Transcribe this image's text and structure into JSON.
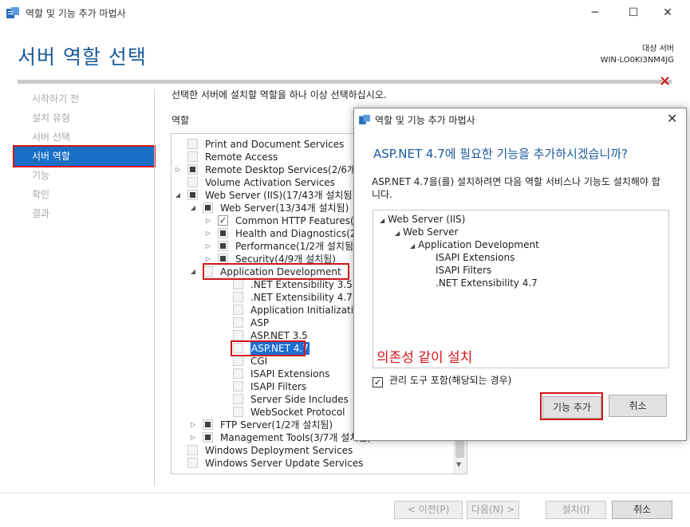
{
  "window": {
    "title": "역할 및 기능 추가 마법사",
    "minimize": "─",
    "maximize": "☐",
    "close": "✕"
  },
  "page": {
    "title": "서버 역할 선택",
    "target_label": "대상 서버",
    "target_server": "WIN-LO0KI3NM4JG",
    "close_mark": "✕"
  },
  "sidebar": {
    "items": [
      {
        "label": "시작하기 전",
        "active": false
      },
      {
        "label": "설치 유형",
        "active": false
      },
      {
        "label": "서버 선택",
        "active": false
      },
      {
        "label": "서버 역할",
        "active": true
      },
      {
        "label": "기능",
        "active": false
      },
      {
        "label": "확인",
        "active": false
      },
      {
        "label": "결과",
        "active": false
      }
    ]
  },
  "main": {
    "instruction": "선택한 서버에 설치할 역할을 하나 이상 선택하십시오.",
    "roles_heading": "역할",
    "tree": [
      {
        "label": "Print and Document Services",
        "state": "empty",
        "arrow": ""
      },
      {
        "label": "Remote Access",
        "state": "empty",
        "arrow": ""
      },
      {
        "label": "Remote Desktop Services(2/6개 설치됨)",
        "state": "partial",
        "arrow": "▷"
      },
      {
        "label": "Volume Activation Services",
        "state": "empty",
        "arrow": ""
      },
      {
        "label": "Web Server (IIS)(17/43개 설치됨)",
        "state": "partial",
        "arrow": "◢"
      },
      {
        "label": "Web Server(13/34개 설치됨)",
        "state": "partial",
        "arrow": "◢"
      },
      {
        "label": "Common HTTP Features(설치됨)",
        "state": "checked",
        "arrow": "▷"
      },
      {
        "label": "Health and Diagnostics(2/6개 설치됨)",
        "state": "partial",
        "arrow": "▷"
      },
      {
        "label": "Performance(1/2개 설치됨)",
        "state": "partial",
        "arrow": "▷"
      },
      {
        "label": "Security(4/9개 설치됨)",
        "state": "partial",
        "arrow": "▷"
      },
      {
        "label": "Application Development",
        "state": "empty",
        "arrow": "◢"
      },
      {
        "label": ".NET Extensibility 3.5",
        "state": "empty",
        "arrow": ""
      },
      {
        "label": ".NET Extensibility 4.7",
        "state": "empty",
        "arrow": ""
      },
      {
        "label": "Application Initialization",
        "state": "empty",
        "arrow": ""
      },
      {
        "label": "ASP",
        "state": "empty",
        "arrow": ""
      },
      {
        "label": "ASP.NET 3.5",
        "state": "empty",
        "arrow": ""
      },
      {
        "label": "ASP.NET 4.7",
        "state": "empty",
        "arrow": ""
      },
      {
        "label": "CGI",
        "state": "empty",
        "arrow": ""
      },
      {
        "label": "ISAPI Extensions",
        "state": "empty",
        "arrow": ""
      },
      {
        "label": "ISAPI Filters",
        "state": "empty",
        "arrow": ""
      },
      {
        "label": "Server Side Includes",
        "state": "empty",
        "arrow": ""
      },
      {
        "label": "WebSocket Protocol",
        "state": "empty",
        "arrow": ""
      },
      {
        "label": "FTP Server(1/2개 설치됨)",
        "state": "partial",
        "arrow": "▷"
      },
      {
        "label": "Management Tools(3/7개 설치됨)",
        "state": "partial",
        "arrow": "▷"
      },
      {
        "label": "Windows Deployment Services",
        "state": "empty",
        "arrow": ""
      },
      {
        "label": "Windows Server Update Services",
        "state": "empty",
        "arrow": ""
      }
    ]
  },
  "footer": {
    "prev": "< 이전(P)",
    "next": "다음(N) >",
    "install": "설치(I)",
    "cancel": "취소"
  },
  "dialog": {
    "title": "역할 및 기능 추가 마법사",
    "close": "✕",
    "headline": "ASP.NET 4.7에 필요한 기능을 추가하시겠습니까?",
    "description": "ASP.NET 4.7을(를) 설치하려면 다음 역할 서비스나 기능도 설치해야 합니다.",
    "features": [
      {
        "label": "Web Server (IIS)",
        "arrow": "◢"
      },
      {
        "label": "Web Server",
        "arrow": "◢"
      },
      {
        "label": "Application Development",
        "arrow": "◢"
      },
      {
        "label": "ISAPI Extensions",
        "arrow": ""
      },
      {
        "label": "ISAPI Filters",
        "arrow": ""
      },
      {
        "label": ".NET Extensibility 4.7",
        "arrow": ""
      }
    ],
    "annotation": "의존성 같이 설치",
    "include_mgmt": "관리 도구 포함(해당되는 경우)",
    "include_mgmt_checked": "✓",
    "add_button": "기능 추가",
    "cancel_button": "취소"
  }
}
